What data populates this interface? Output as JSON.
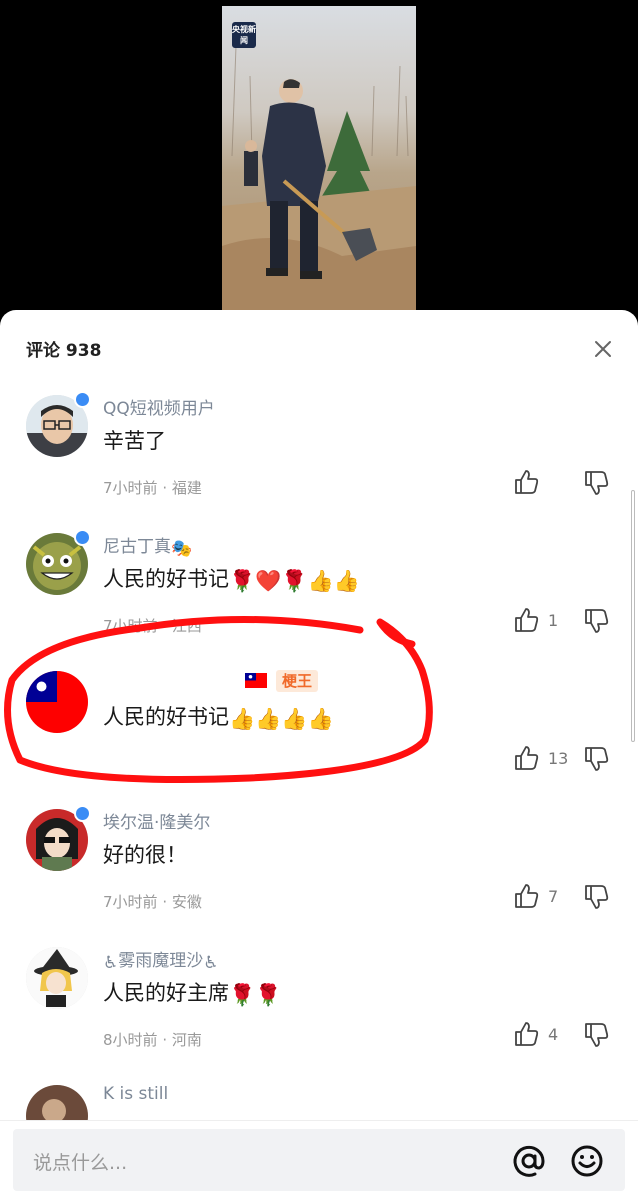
{
  "video": {
    "channel_logo": "央视新闻"
  },
  "header": {
    "title": "评论 938"
  },
  "comments": [
    {
      "username": "QQ短视频用户",
      "text": "辛苦了",
      "time": "7小时前",
      "location": "福建",
      "likes": "",
      "verified": true,
      "avatar": "avatar-boy-glasses"
    },
    {
      "username": "尼古丁真",
      "username_suffix_emoji": "🎭",
      "text": "人民的好书记",
      "text_emoji": "🌹❤️🌹👍👍",
      "time": "7小时前",
      "location": "江西",
      "likes": "1",
      "verified": true,
      "avatar": "avatar-cartoon-monster"
    },
    {
      "username": "",
      "flag_emoji": "🇹🇼",
      "tag": "梗王",
      "text": "人民的好书记",
      "text_emoji": "👍👍👍👍",
      "likes": "13",
      "verified": false,
      "avatar": "avatar-flag"
    },
    {
      "username": "埃尔温·隆美尔",
      "text": "好的很！",
      "time": "7小时前",
      "location": "安徽",
      "likes": "7",
      "verified": true,
      "avatar": "avatar-anime-sunglasses"
    },
    {
      "username": "雾雨魔理沙",
      "username_prefix_emoji": "♿",
      "username_suffix_emoji": "♿",
      "text": "人民的好主席",
      "text_emoji": "🌹🌹",
      "time": "8小时前",
      "location": "河南",
      "likes": "4",
      "verified": false,
      "avatar": "avatar-anime-witch"
    },
    {
      "username": "K is still",
      "avatar": "avatar-photo"
    }
  ],
  "meta_separator": " · ",
  "input": {
    "placeholder": "说点什么..."
  },
  "colors": {
    "accent_blue": "#3a8cf5",
    "annotation_red": "#ff1010",
    "tag_orange": "#f06a2a"
  }
}
